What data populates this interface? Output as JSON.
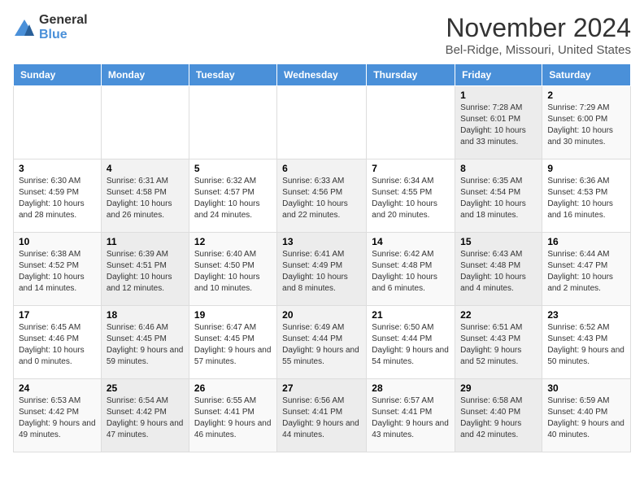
{
  "logo": {
    "general": "General",
    "blue": "Blue"
  },
  "header": {
    "month": "November 2024",
    "location": "Bel-Ridge, Missouri, United States"
  },
  "weekdays": [
    "Sunday",
    "Monday",
    "Tuesday",
    "Wednesday",
    "Thursday",
    "Friday",
    "Saturday"
  ],
  "weeks": [
    [
      {
        "day": "",
        "content": ""
      },
      {
        "day": "",
        "content": ""
      },
      {
        "day": "",
        "content": ""
      },
      {
        "day": "",
        "content": ""
      },
      {
        "day": "",
        "content": ""
      },
      {
        "day": "1",
        "content": "Sunrise: 7:28 AM\nSunset: 6:01 PM\nDaylight: 10 hours and 33 minutes."
      },
      {
        "day": "2",
        "content": "Sunrise: 7:29 AM\nSunset: 6:00 PM\nDaylight: 10 hours and 30 minutes."
      }
    ],
    [
      {
        "day": "3",
        "content": "Sunrise: 6:30 AM\nSunset: 4:59 PM\nDaylight: 10 hours and 28 minutes."
      },
      {
        "day": "4",
        "content": "Sunrise: 6:31 AM\nSunset: 4:58 PM\nDaylight: 10 hours and 26 minutes."
      },
      {
        "day": "5",
        "content": "Sunrise: 6:32 AM\nSunset: 4:57 PM\nDaylight: 10 hours and 24 minutes."
      },
      {
        "day": "6",
        "content": "Sunrise: 6:33 AM\nSunset: 4:56 PM\nDaylight: 10 hours and 22 minutes."
      },
      {
        "day": "7",
        "content": "Sunrise: 6:34 AM\nSunset: 4:55 PM\nDaylight: 10 hours and 20 minutes."
      },
      {
        "day": "8",
        "content": "Sunrise: 6:35 AM\nSunset: 4:54 PM\nDaylight: 10 hours and 18 minutes."
      },
      {
        "day": "9",
        "content": "Sunrise: 6:36 AM\nSunset: 4:53 PM\nDaylight: 10 hours and 16 minutes."
      }
    ],
    [
      {
        "day": "10",
        "content": "Sunrise: 6:38 AM\nSunset: 4:52 PM\nDaylight: 10 hours and 14 minutes."
      },
      {
        "day": "11",
        "content": "Sunrise: 6:39 AM\nSunset: 4:51 PM\nDaylight: 10 hours and 12 minutes."
      },
      {
        "day": "12",
        "content": "Sunrise: 6:40 AM\nSunset: 4:50 PM\nDaylight: 10 hours and 10 minutes."
      },
      {
        "day": "13",
        "content": "Sunrise: 6:41 AM\nSunset: 4:49 PM\nDaylight: 10 hours and 8 minutes."
      },
      {
        "day": "14",
        "content": "Sunrise: 6:42 AM\nSunset: 4:48 PM\nDaylight: 10 hours and 6 minutes."
      },
      {
        "day": "15",
        "content": "Sunrise: 6:43 AM\nSunset: 4:48 PM\nDaylight: 10 hours and 4 minutes."
      },
      {
        "day": "16",
        "content": "Sunrise: 6:44 AM\nSunset: 4:47 PM\nDaylight: 10 hours and 2 minutes."
      }
    ],
    [
      {
        "day": "17",
        "content": "Sunrise: 6:45 AM\nSunset: 4:46 PM\nDaylight: 10 hours and 0 minutes."
      },
      {
        "day": "18",
        "content": "Sunrise: 6:46 AM\nSunset: 4:45 PM\nDaylight: 9 hours and 59 minutes."
      },
      {
        "day": "19",
        "content": "Sunrise: 6:47 AM\nSunset: 4:45 PM\nDaylight: 9 hours and 57 minutes."
      },
      {
        "day": "20",
        "content": "Sunrise: 6:49 AM\nSunset: 4:44 PM\nDaylight: 9 hours and 55 minutes."
      },
      {
        "day": "21",
        "content": "Sunrise: 6:50 AM\nSunset: 4:44 PM\nDaylight: 9 hours and 54 minutes."
      },
      {
        "day": "22",
        "content": "Sunrise: 6:51 AM\nSunset: 4:43 PM\nDaylight: 9 hours and 52 minutes."
      },
      {
        "day": "23",
        "content": "Sunrise: 6:52 AM\nSunset: 4:43 PM\nDaylight: 9 hours and 50 minutes."
      }
    ],
    [
      {
        "day": "24",
        "content": "Sunrise: 6:53 AM\nSunset: 4:42 PM\nDaylight: 9 hours and 49 minutes."
      },
      {
        "day": "25",
        "content": "Sunrise: 6:54 AM\nSunset: 4:42 PM\nDaylight: 9 hours and 47 minutes."
      },
      {
        "day": "26",
        "content": "Sunrise: 6:55 AM\nSunset: 4:41 PM\nDaylight: 9 hours and 46 minutes."
      },
      {
        "day": "27",
        "content": "Sunrise: 6:56 AM\nSunset: 4:41 PM\nDaylight: 9 hours and 44 minutes."
      },
      {
        "day": "28",
        "content": "Sunrise: 6:57 AM\nSunset: 4:41 PM\nDaylight: 9 hours and 43 minutes."
      },
      {
        "day": "29",
        "content": "Sunrise: 6:58 AM\nSunset: 4:40 PM\nDaylight: 9 hours and 42 minutes."
      },
      {
        "day": "30",
        "content": "Sunrise: 6:59 AM\nSunset: 4:40 PM\nDaylight: 9 hours and 40 minutes."
      }
    ]
  ]
}
